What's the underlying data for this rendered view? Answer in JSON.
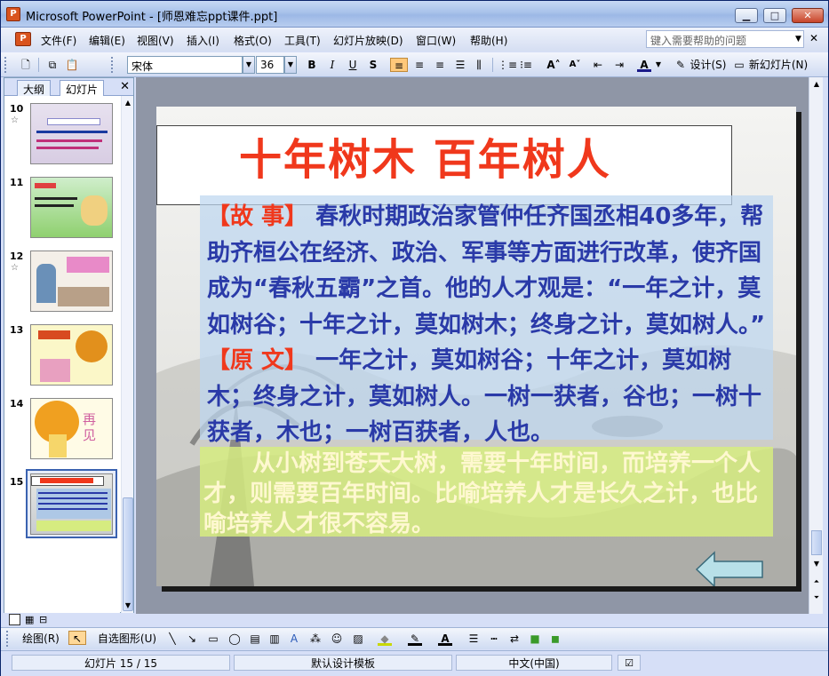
{
  "window": {
    "title": "Microsoft PowerPoint - [师恩难忘ppt课件.ppt]"
  },
  "menu": [
    "文件(F)",
    "编辑(E)",
    "视图(V)",
    "插入(I)",
    "格式(O)",
    "工具(T)",
    "幻灯片放映(D)",
    "窗口(W)",
    "帮助(H)"
  ],
  "help_placeholder": "键入需要帮助的问题",
  "toolbar": {
    "font": "宋体",
    "size": "36",
    "design_label": "设计(S)",
    "new_slide_label": "新幻灯片(N)"
  },
  "panel": {
    "tab_outline": "大纲",
    "tab_slides": "幻灯片",
    "slides": [
      {
        "num": "10",
        "star": true
      },
      {
        "num": "11",
        "star": false
      },
      {
        "num": "12",
        "star": true
      },
      {
        "num": "13",
        "star": false
      },
      {
        "num": "14",
        "star": false,
        "text": "再见"
      },
      {
        "num": "15",
        "star": false,
        "selected": true
      }
    ]
  },
  "slide": {
    "title": "十年树木  百年树人",
    "story_tag": "【故 事】",
    "story_text": "春秋时期政治家管仲任齐国丞相40多年，帮助齐桓公在经济、政治、军事等方面进行改革，使齐国成为“春秋五霸”之首。他的人才观是：“一年之计，莫如树谷；十年之计，莫如树木；终身之计，莫如树人。”",
    "origin_tag": "【原 文】",
    "origin_text": "一年之计，莫如树谷；十年之计，莫如树木；终身之计，莫如树人。一树一获者，谷也；一树十获者，木也；一树百获者，人也。",
    "summary": "从小树到苍天大树，需要十年时间，而培养一个人才，则需要百年时间。比喻培养人才是长久之计，也比喻培养人才很不容易。"
  },
  "drawbar": {
    "draw_label": "绘图(R)",
    "autoshape_label": "自选图形(U)"
  },
  "status": {
    "slide_info": "幻灯片 15 / 15",
    "template": "默认设计模板",
    "language": "中文(中国)"
  }
}
